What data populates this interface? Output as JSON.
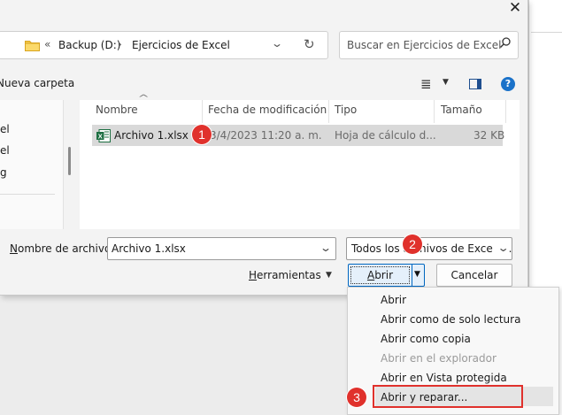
{
  "window": {
    "close_glyph": "✕"
  },
  "address_bar": {
    "back_glyph": "«",
    "crumbs": [
      "Backup (D:)",
      "Ejercicios de Excel"
    ],
    "separator": "›",
    "dropdown_glyph": "⌄",
    "refresh_glyph": "↻"
  },
  "search": {
    "placeholder": "Buscar en Ejercicios de Excel",
    "icon": "search-icon"
  },
  "toolbar": {
    "new_folder": "Nueva carpeta",
    "view_glyph": "≣",
    "view_chevron": "▼",
    "help": "?"
  },
  "nav": {
    "items": [
      "el",
      "el",
      "g"
    ]
  },
  "columns": [
    "Nombre",
    "Fecha de modificación",
    "Tipo",
    "Tamaño"
  ],
  "files": [
    {
      "name": "Archivo 1.xlsx",
      "date": "3/4/2023 11:20 a. m.",
      "type": "Hoja de cálculo d...",
      "size": "32 KB",
      "selected": true
    }
  ],
  "filename_label": "Nombre de archivo:",
  "filename_value": "Archivo 1.xlsx",
  "filter_value": "Todos los archivos de Excel (*.x",
  "tools_label": "Herramientas",
  "open_label": "Abrir",
  "cancel_label": "Cancelar",
  "open_menu": [
    {
      "label": "Abrir",
      "enabled": true
    },
    {
      "label": "Abrir como de solo lectura",
      "enabled": true
    },
    {
      "label": "Abrir como copia",
      "enabled": true
    },
    {
      "label": "Abrir en el explorador",
      "enabled": false
    },
    {
      "label": "Abrir en Vista protegida",
      "enabled": true
    },
    {
      "label": "Abrir y reparar...",
      "enabled": true,
      "highlighted": true
    }
  ],
  "badges": [
    "1",
    "2",
    "3"
  ],
  "colors": {
    "accent": "#0067c0",
    "badge": "#e0312c",
    "selection": "#d9d9d9",
    "excel_green": "#1d6f42"
  }
}
